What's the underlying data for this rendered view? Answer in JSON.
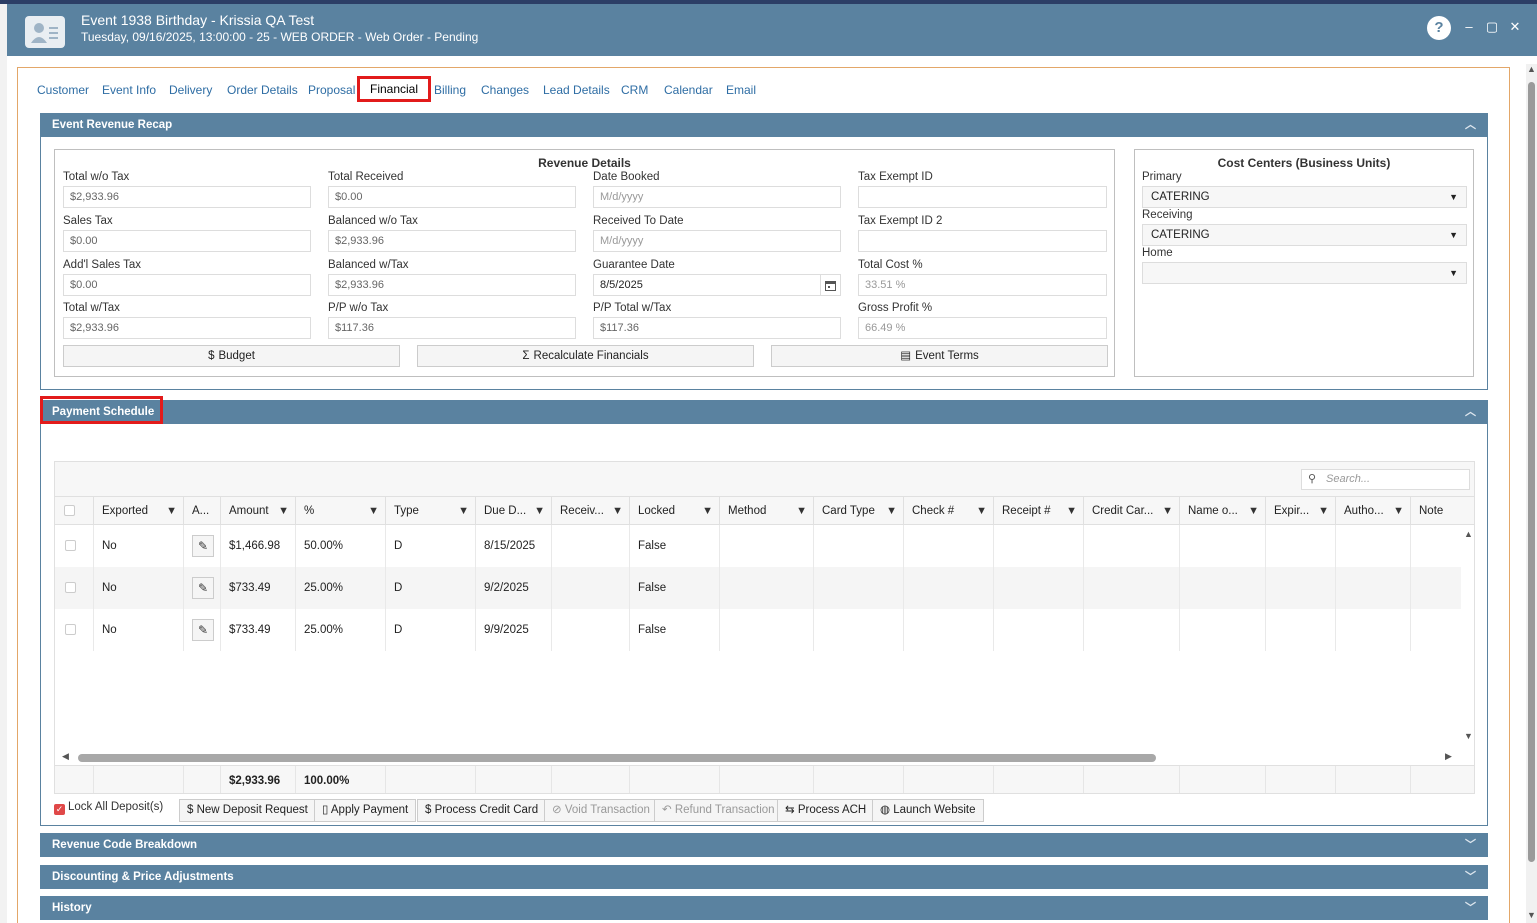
{
  "window": {
    "title": "Event 1938 Birthday - Krissia QA Test",
    "subtitle": "Tuesday, 09/16/2025, 13:00:00 - 25 - WEB ORDER - Web Order - Pending",
    "help": "?",
    "minimize": "–",
    "maximize": "▢",
    "close": "✕"
  },
  "tabs": [
    "Customer",
    "Event Info",
    "Delivery",
    "Order Details",
    "Proposal",
    "Financial",
    "Billing",
    "Changes",
    "Lead Details",
    "CRM",
    "Calendar",
    "Email"
  ],
  "active_tab": "Financial",
  "recap": {
    "header": "Event Revenue Recap",
    "revenue_details": {
      "title": "Revenue Details",
      "total_wo_tax_label": "Total w/o Tax",
      "total_wo_tax": "$2,933.96",
      "total_received_label": "Total Received",
      "total_received": "$0.00",
      "date_booked_label": "Date Booked",
      "date_booked_ph": "M/d/yyyy",
      "tax_exempt_id_label": "Tax Exempt ID",
      "tax_exempt_id": "",
      "sales_tax_label": "Sales Tax",
      "sales_tax": "$0.00",
      "balanced_wo_tax_label": "Balanced w/o Tax",
      "balanced_wo_tax": "$2,933.96",
      "received_to_date_label": "Received To Date",
      "received_to_date_ph": "M/d/yyyy",
      "tax_exempt_id2_label": "Tax Exempt ID 2",
      "tax_exempt_id2": "",
      "addl_sales_tax_label": "Add'l Sales Tax",
      "addl_sales_tax": "$0.00",
      "balanced_w_tax_label": "Balanced w/Tax",
      "balanced_w_tax": "$2,933.96",
      "guarantee_date_label": "Guarantee Date",
      "guarantee_date": "8/5/2025",
      "total_cost_pct_label": "Total Cost %",
      "total_cost_pct": "33.51 %",
      "total_w_tax_label": "Total w/Tax",
      "total_w_tax": "$2,933.96",
      "pp_wo_tax_label": "P/P w/o Tax",
      "pp_wo_tax": "$117.36",
      "pp_total_w_tax_label": "P/P Total w/Tax",
      "pp_total_w_tax": "$117.36",
      "gross_profit_pct_label": "Gross Profit %",
      "gross_profit_pct": "66.49 %",
      "budget_btn": "Budget",
      "recalc_btn": "Recalculate Financials",
      "terms_btn": "Event Terms"
    },
    "cost_centers": {
      "title": "Cost Centers (Business Units)",
      "primary_label": "Primary",
      "primary": "CATERING",
      "receiving_label": "Receiving",
      "receiving": "CATERING",
      "home_label": "Home",
      "home": ""
    }
  },
  "payment_schedule": {
    "header": "Payment Schedule",
    "search_ph": "Search...",
    "columns": [
      "Exported",
      "A...",
      "Amount",
      "%",
      "Type",
      "Due D...",
      "Receiv...",
      "Locked",
      "Method",
      "Card Type",
      "Check #",
      "Receipt #",
      "Credit Car...",
      "Name o...",
      "Expir...",
      "Autho...",
      "Note"
    ],
    "rows": [
      {
        "exported": "No",
        "amount": "$1,466.98",
        "pct": "50.00%",
        "type": "D",
        "due": "8/15/2025",
        "locked": "False"
      },
      {
        "exported": "No",
        "amount": "$733.49",
        "pct": "25.00%",
        "type": "D",
        "due": "9/2/2025",
        "locked": "False"
      },
      {
        "exported": "No",
        "amount": "$733.49",
        "pct": "25.00%",
        "type": "D",
        "due": "9/9/2025",
        "locked": "False"
      }
    ],
    "footer_amount": "$2,933.96",
    "footer_pct": "100.00%",
    "lock_all_label": "Lock All Deposit(s)",
    "actions": [
      "New Deposit Request",
      "Apply Payment",
      "Process Credit Card",
      "Void Transaction",
      "Refund Transaction",
      "Process ACH",
      "Launch Website"
    ]
  },
  "collapsed_panels": [
    "Revenue Code Breakdown",
    "Discounting & Price Adjustments",
    "History"
  ],
  "colors": {
    "header_bg": "#5a82a0",
    "highlight": "#e21b1b",
    "frame_border": "#e3a769",
    "link": "#2e6da4"
  }
}
